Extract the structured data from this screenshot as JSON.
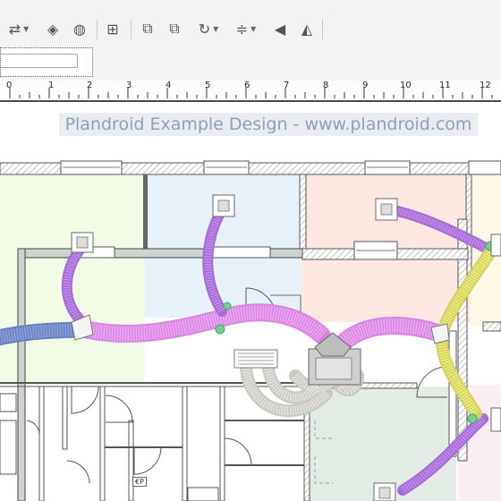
{
  "toolbar": {
    "tools": [
      {
        "icon": "shuffle-icon",
        "glyph": "⇄",
        "has_menu": true
      },
      {
        "icon": "eraser-icon",
        "glyph": "◈",
        "has_menu": false
      },
      {
        "icon": "compass-icon",
        "glyph": "◍",
        "has_menu": false
      },
      {
        "icon": "grid-snap-icon",
        "glyph": "⊞",
        "has_menu": false
      },
      {
        "icon": "bring-forward-icon",
        "glyph": "⧉",
        "has_menu": false
      },
      {
        "icon": "send-backward-icon",
        "glyph": "⧉",
        "has_menu": false
      },
      {
        "icon": "rotate-icon",
        "glyph": "↻",
        "has_menu": true
      },
      {
        "icon": "align-icon",
        "glyph": "≑",
        "has_menu": true
      },
      {
        "icon": "flip-horizontal-icon",
        "glyph": "◀",
        "has_menu": false
      },
      {
        "icon": "mirror-icon",
        "glyph": "◭",
        "has_menu": false
      }
    ]
  },
  "ruler": {
    "labels": [
      "0",
      "1",
      "2",
      "3",
      "4",
      "5",
      "6",
      "7",
      "8",
      "9",
      "10",
      "11",
      "12"
    ]
  },
  "design": {
    "title": "Plandroid Example Design - www.plandroid.com",
    "room_tag": "€P"
  },
  "colors": {
    "room_green": "#f2fbe6",
    "room_blue": "#e7f1fa",
    "room_salmon": "#fde8e1",
    "room_yellow": "#fff8e6",
    "room_gray_green": "#e3ebe5",
    "room_pink": "#f9eef4",
    "duct_purple": "#b57be3",
    "duct_pink": "#e8a0ee",
    "duct_blue": "#8ba3dd",
    "duct_yellow": "#e8e876",
    "duct_gray": "#d9d9d4",
    "wall": "#555555"
  }
}
